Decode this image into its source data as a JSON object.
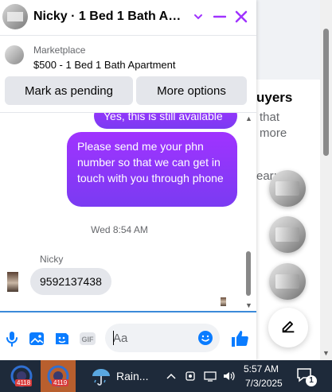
{
  "background": {
    "heading_partial": "uyers",
    "line1": "that",
    "line2": "more",
    "line3": "ear:"
  },
  "chat": {
    "title": "Nicky · 1 Bed 1 Bath Apartment",
    "product_category": "Marketplace",
    "product_title": "$500 - 1 Bed 1 Bath Apartment",
    "mark_pending_label": "Mark as pending",
    "more_options_label": "More options",
    "accent_color": "#a033ff",
    "messages": {
      "sent_partial": "Yes, this is still available",
      "sent_main": "Please send me your phn number so that we can get in touch with you through phone",
      "timestamp": "Wed 8:54 AM",
      "sender_name": "Nicky",
      "received": "9592137438"
    },
    "composer": {
      "placeholder": "Aa"
    }
  },
  "taskbar": {
    "app1_badge": "4118",
    "app2_badge": "4119",
    "weather_label": "Rain...",
    "time": "5:57 AM",
    "date": "7/3/2025",
    "notification_count": "1"
  }
}
